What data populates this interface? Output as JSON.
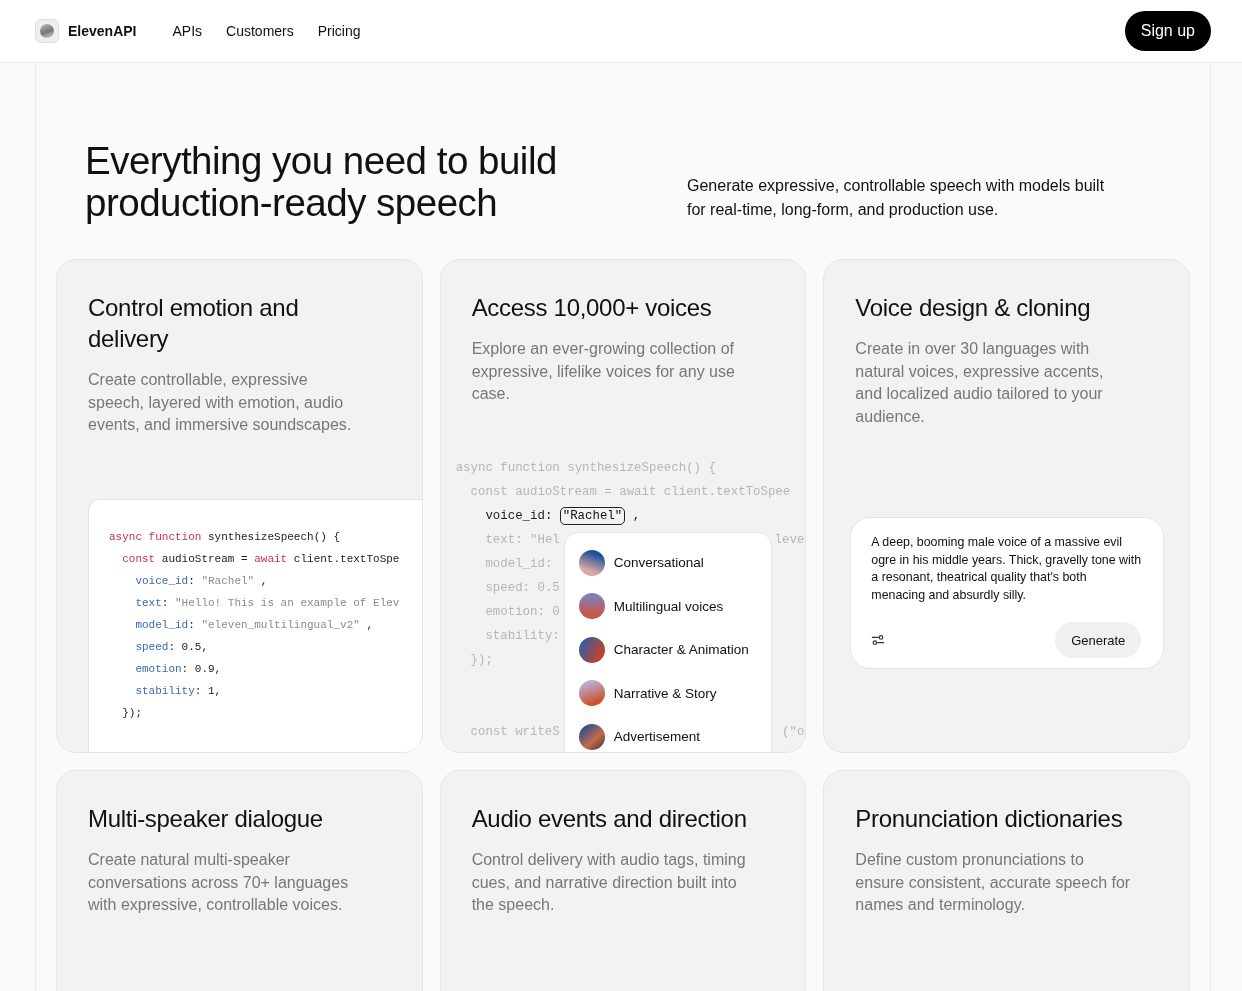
{
  "header": {
    "brand": "ElevenAPI",
    "nav": [
      "APIs",
      "Customers",
      "Pricing"
    ],
    "signup": "Sign up"
  },
  "hero": {
    "title": "Everything you need to build production-ready speech",
    "subtitle": "Generate expressive, controllable speech with models built for real-time, long-form, and production use."
  },
  "cards": [
    {
      "title": "Control emotion and delivery",
      "text": "Create controllable, expressive speech, layered with emotion, audio events, and immersive soundscapes.",
      "kind": "code",
      "code": [
        [
          {
            "kind": "keyword",
            "text": "async function"
          },
          {
            "kind": "plain",
            "text": "synthesizeSpeech() {"
          }
        ],
        [
          {
            "kind": "keyword",
            "text": "const"
          },
          {
            "kind": "plain",
            "text": "audioStream ="
          },
          {
            "kind": "keyword",
            "text": "await"
          },
          {
            "kind": "plain",
            "text": "client.textToSpe"
          }
        ],
        [
          {
            "kind": "property",
            "text": "voice_id"
          },
          {
            "kind": "plain",
            "text": ":"
          },
          {
            "kind": "string",
            "text": "\"Rachel\""
          },
          {
            "kind": "plain",
            "text": ","
          }
        ],
        [
          {
            "kind": "property",
            "text": "text"
          },
          {
            "kind": "plain",
            "text": ":"
          },
          {
            "kind": "string",
            "text": "\"Hello! This is an example of Elev"
          }
        ],
        [
          {
            "kind": "property",
            "text": "model_id"
          },
          {
            "kind": "plain",
            "text": ":"
          },
          {
            "kind": "string",
            "text": "\"eleven_multilingual_v2\""
          },
          {
            "kind": "plain",
            "text": ","
          }
        ],
        [
          {
            "kind": "property",
            "text": "speed"
          },
          {
            "kind": "plain",
            "text": ": 0.5,"
          }
        ],
        [
          {
            "kind": "property",
            "text": "emotion"
          },
          {
            "kind": "plain",
            "text": ": 0.9,"
          }
        ],
        [
          {
            "kind": "property",
            "text": "stability"
          },
          {
            "kind": "plain",
            "text": ": 1,"
          }
        ],
        [
          {
            "kind": "plain",
            "text": "});"
          }
        ]
      ]
    },
    {
      "title": "Access 10,000+ voices",
      "text": "Explore an ever-growing collection of expressive, lifelike voices for any use case.",
      "kind": "voices",
      "code": [
        {
          "tokens": [
            {
              "kind": "dim",
              "text": "async function synthesizeSpeech() {"
            }
          ]
        },
        {
          "tokens": [
            {
              "kind": "dim",
              "text": "const audioStream = await client.textToSpee"
            }
          ]
        },
        {
          "tokens": [
            {
              "kind": "plain",
              "text": "voice_id:"
            },
            {
              "kind": "boxed",
              "text": "\"Rachel\""
            },
            {
              "kind": "plain",
              "text": ","
            }
          ]
        },
        {
          "tokens": [
            {
              "kind": "dim",
              "text": "text: \"Hel"
            }
          ],
          "right": "leve"
        },
        {
          "tokens": [
            {
              "kind": "dim",
              "text": "model_id:"
            }
          ]
        },
        {
          "tokens": [
            {
              "kind": "dim",
              "text": "speed: 0.5"
            }
          ]
        },
        {
          "tokens": [
            {
              "kind": "dim",
              "text": "emotion: 0"
            }
          ]
        },
        {
          "tokens": [
            {
              "kind": "dim",
              "text": "stability:"
            }
          ]
        },
        {
          "tokens": [
            {
              "kind": "dim",
              "text": "});"
            }
          ]
        },
        {
          "tokens": [
            {
              "kind": "dim",
              "text": "const writeS"
            }
          ],
          "right": "(\"o"
        }
      ],
      "voices": [
        "Conversational",
        "Multilingual voices",
        "Character & Animation",
        "Narrative & Story",
        "Advertisement"
      ]
    },
    {
      "title": "Voice design & cloning",
      "text": "Create in over 30 languages with natural voices, expressive accents, and localized audio tailored to your audience.",
      "kind": "prompt",
      "prompt": "A deep, booming male voice of a massive evil ogre in his middle years. Thick, gravelly tone with a resonant, theatrical quality that's both menacing and absurdly silly.",
      "button": "Generate"
    },
    {
      "title": "Multi-speaker dialogue",
      "text": "Create natural multi-speaker conversations across 70+ languages with expressive, controllable voices.",
      "kind": "chat"
    },
    {
      "title": "Audio events and direction",
      "text": "Control delivery with audio tags, timing cues, and narrative direction built into the speech.",
      "kind": "panel"
    },
    {
      "title": "Pronunciation dictionaries",
      "text": "Define custom pronunciations to ensure consistent, accurate speech for names and terminology.",
      "kind": "panel"
    }
  ]
}
